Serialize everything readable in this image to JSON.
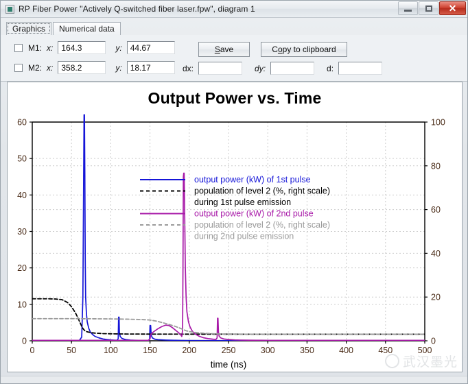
{
  "window": {
    "title": "RP Fiber Power \"Actively Q-switched fiber laser.fpw\", diagram 1",
    "icon": "application-icon",
    "minimize_label": "",
    "maximize_label": "",
    "close_label": "✕"
  },
  "tabs": [
    {
      "label": "Graphics",
      "active": true
    },
    {
      "label": "Numerical data",
      "active": false
    }
  ],
  "markers": {
    "m1": {
      "name": "M1:",
      "x_label": "x:",
      "x_value": "164.3",
      "y_label": "y:",
      "y_value": "44.67",
      "checked": false
    },
    "m2": {
      "name": "M2:",
      "x_label": "x:",
      "x_value": "358.2",
      "y_label": "y:",
      "y_value": "18.17",
      "checked": false
    },
    "dx_label": "dx:",
    "dx_value": "",
    "dy_label": "dy:",
    "dy_value": "",
    "d_label": "d:",
    "d_value": ""
  },
  "buttons": {
    "save": "Save",
    "save_accel": "S",
    "copy": "Copy to clipboard",
    "copy_accel": "o"
  },
  "watermark": {
    "text": "武汉墨光"
  },
  "chart_data": {
    "type": "line",
    "title": "Output Power vs. Time",
    "xlabel": "time (ns)",
    "ylabel": "",
    "y2label": "",
    "xlim": [
      0,
      500
    ],
    "ylim": [
      0,
      60
    ],
    "y2lim": [
      0,
      100
    ],
    "xticks": [
      0,
      50,
      100,
      150,
      200,
      250,
      300,
      350,
      400,
      450,
      500
    ],
    "yticks": [
      0,
      10,
      20,
      30,
      40,
      50,
      60
    ],
    "y2ticks": [
      0,
      20,
      40,
      60,
      80,
      100
    ],
    "grid": true,
    "legend_position": "upper-center",
    "colors": {
      "pulse1": "#1515d8",
      "pop1": "#000000",
      "pulse2": "#a81aa8",
      "pop2": "#9a9a9a",
      "axis": "#000000",
      "grid": "#cccccc",
      "tick_text": "#4a2c18"
    },
    "series": [
      {
        "name": "output power (kW) of 1st pulse",
        "color": "#1515d8",
        "style": "solid",
        "axis": "left",
        "points": [
          [
            0,
            0
          ],
          [
            20,
            0
          ],
          [
            40,
            0
          ],
          [
            55,
            0
          ],
          [
            60,
            0.1
          ],
          [
            63,
            1
          ],
          [
            64.5,
            12
          ],
          [
            65.5,
            45
          ],
          [
            66,
            62
          ],
          [
            66.5,
            62
          ],
          [
            67,
            45
          ],
          [
            67.5,
            22
          ],
          [
            68,
            12
          ],
          [
            69,
            7.5
          ],
          [
            70,
            5.2
          ],
          [
            72,
            3.4
          ],
          [
            74,
            2.4
          ],
          [
            77,
            1.7
          ],
          [
            80,
            1.2
          ],
          [
            85,
            0.8
          ],
          [
            90,
            0.5
          ],
          [
            95,
            0.35
          ],
          [
            100,
            0.25
          ],
          [
            105,
            0.18
          ],
          [
            108,
            0.15
          ],
          [
            109.5,
            0.6
          ],
          [
            110,
            6.5
          ],
          [
            110.6,
            6.5
          ],
          [
            111,
            2.4
          ],
          [
            112,
            1.2
          ],
          [
            114,
            0.7
          ],
          [
            117,
            0.45
          ],
          [
            120,
            0.3
          ],
          [
            125,
            0.2
          ],
          [
            130,
            0.15
          ],
          [
            140,
            0.1
          ],
          [
            148,
            0.08
          ],
          [
            149.5,
            0.5
          ],
          [
            150,
            4.2
          ],
          [
            150.8,
            4.2
          ],
          [
            151.5,
            1.6
          ],
          [
            153,
            0.8
          ],
          [
            156,
            0.45
          ],
          [
            160,
            0.3
          ],
          [
            170,
            0.2
          ],
          [
            180,
            0.14
          ],
          [
            190,
            0.1
          ],
          [
            192,
            0.1
          ],
          [
            200,
            0.08
          ],
          [
            220,
            0.06
          ],
          [
            250,
            0.05
          ],
          [
            300,
            0.04
          ],
          [
            350,
            0.03
          ],
          [
            400,
            0.03
          ],
          [
            450,
            0.02
          ],
          [
            500,
            0.02
          ]
        ]
      },
      {
        "name": "population of level 2 (%, right scale) during 1st pulse emission",
        "color": "#000000",
        "style": "dashed",
        "axis": "right",
        "points": [
          [
            0,
            19.2
          ],
          [
            10,
            19.2
          ],
          [
            20,
            19.2
          ],
          [
            30,
            19.1
          ],
          [
            38,
            18.8
          ],
          [
            45,
            17.5
          ],
          [
            50,
            15.6
          ],
          [
            55,
            12.8
          ],
          [
            58,
            10.6
          ],
          [
            61,
            8.2
          ],
          [
            63,
            6.6
          ],
          [
            65,
            5.4
          ],
          [
            67,
            4.6
          ],
          [
            70,
            4.1
          ],
          [
            75,
            3.7
          ],
          [
            80,
            3.5
          ],
          [
            90,
            3.3
          ],
          [
            100,
            3.2
          ],
          [
            110,
            3.15
          ],
          [
            120,
            3.1
          ],
          [
            140,
            3.08
          ],
          [
            160,
            3.05
          ],
          [
            180,
            3.05
          ],
          [
            200,
            3.04
          ],
          [
            250,
            3.03
          ],
          [
            300,
            3.02
          ],
          [
            350,
            3.02
          ],
          [
            400,
            3.02
          ],
          [
            450,
            3.01
          ],
          [
            500,
            3.01
          ]
        ]
      },
      {
        "name": "output power (kW) of 2nd pulse",
        "color": "#a81aa8",
        "style": "solid",
        "axis": "left",
        "points": [
          [
            0,
            0.12
          ],
          [
            20,
            0.12
          ],
          [
            40,
            0.12
          ],
          [
            60,
            0.12
          ],
          [
            80,
            0.12
          ],
          [
            100,
            0.12
          ],
          [
            120,
            0.12
          ],
          [
            140,
            0.13
          ],
          [
            148,
            0.15
          ],
          [
            150,
            0.5
          ],
          [
            151,
            1.7
          ],
          [
            153,
            2.2
          ],
          [
            156,
            2.7
          ],
          [
            160,
            3.3
          ],
          [
            165,
            3.9
          ],
          [
            170,
            4.3
          ],
          [
            174,
            4.2
          ],
          [
            178,
            3.7
          ],
          [
            182,
            3.0
          ],
          [
            186,
            2.3
          ],
          [
            189,
            1.7
          ],
          [
            190.5,
            1.2
          ],
          [
            191.5,
            3
          ],
          [
            192,
            20
          ],
          [
            192.5,
            45
          ],
          [
            193,
            46
          ],
          [
            193.5,
            46
          ],
          [
            194,
            38
          ],
          [
            195,
            20
          ],
          [
            196,
            12
          ],
          [
            197,
            8
          ],
          [
            199,
            5.2
          ],
          [
            201,
            3.8
          ],
          [
            204,
            2.6
          ],
          [
            208,
            1.8
          ],
          [
            213,
            1.2
          ],
          [
            218,
            0.85
          ],
          [
            224,
            0.6
          ],
          [
            230,
            0.45
          ],
          [
            234,
            0.38
          ],
          [
            235.5,
            0.8
          ],
          [
            236,
            6.2
          ],
          [
            236.6,
            6.2
          ],
          [
            237.2,
            2.4
          ],
          [
            238,
            1.3
          ],
          [
            240,
            0.8
          ],
          [
            244,
            0.5
          ],
          [
            250,
            0.35
          ],
          [
            258,
            0.25
          ],
          [
            265,
            0.2
          ],
          [
            275,
            0.16
          ],
          [
            285,
            0.14
          ],
          [
            300,
            0.13
          ],
          [
            330,
            0.12
          ],
          [
            370,
            0.12
          ],
          [
            420,
            0.12
          ],
          [
            460,
            0.12
          ],
          [
            500,
            0.12
          ]
        ]
      },
      {
        "name": "population of level 2 (%, right scale) during 2nd pulse emission",
        "color": "#9a9a9a",
        "style": "dashed",
        "axis": "right",
        "points": [
          [
            0,
            10.1
          ],
          [
            20,
            10.1
          ],
          [
            40,
            10.1
          ],
          [
            60,
            10.1
          ],
          [
            80,
            10.05
          ],
          [
            100,
            10.0
          ],
          [
            120,
            9.9
          ],
          [
            140,
            9.7
          ],
          [
            150,
            9.5
          ],
          [
            158,
            9.0
          ],
          [
            166,
            8.3
          ],
          [
            174,
            7.5
          ],
          [
            182,
            6.6
          ],
          [
            188,
            5.8
          ],
          [
            192,
            5.2
          ],
          [
            196,
            4.6
          ],
          [
            202,
            4.1
          ],
          [
            210,
            3.7
          ],
          [
            220,
            3.4
          ],
          [
            232,
            3.2
          ],
          [
            240,
            3.1
          ],
          [
            255,
            3.05
          ],
          [
            275,
            3.02
          ],
          [
            300,
            3.0
          ],
          [
            350,
            3.0
          ],
          [
            400,
            3.0
          ],
          [
            450,
            3.0
          ],
          [
            500,
            3.0
          ]
        ]
      }
    ],
    "legend": [
      {
        "label": "output power (kW) of 1st pulse",
        "color": "#1515d8",
        "style": "solid"
      },
      {
        "label": "population of level 2 (%, right scale)",
        "color": "#000000",
        "style": "dashed"
      },
      {
        "label": "during 1st pulse emission",
        "color": "#000000",
        "style": "none"
      },
      {
        "label": "output power (kW) of 2nd pulse",
        "color": "#a81aa8",
        "style": "solid"
      },
      {
        "label": "population of level 2 (%, right scale)",
        "color": "#9a9a9a",
        "style": "dashed"
      },
      {
        "label": "during 2nd pulse emission",
        "color": "#9a9a9a",
        "style": "none"
      }
    ]
  }
}
